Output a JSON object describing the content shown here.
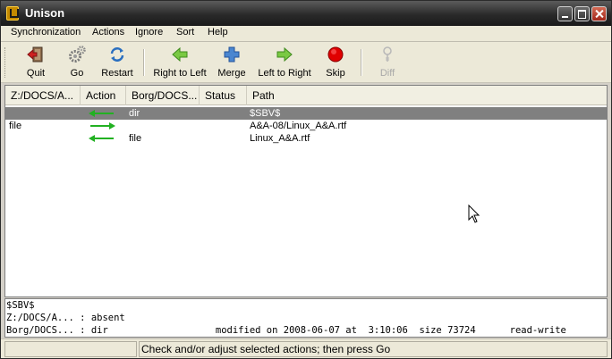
{
  "window": {
    "title": "Unison"
  },
  "menu": [
    "Synchronization",
    "Actions",
    "Ignore",
    "Sort",
    "Help"
  ],
  "toolbar": {
    "buttons": [
      {
        "label": "Quit",
        "icon": "quit-icon",
        "enabled": true
      },
      {
        "label": "Go",
        "icon": "gears-icon",
        "enabled": true
      },
      {
        "label": "Restart",
        "icon": "restart-icon",
        "enabled": true
      },
      {
        "label": "Right to Left",
        "icon": "arrow-left-icon",
        "enabled": true
      },
      {
        "label": "Merge",
        "icon": "plus-icon",
        "enabled": true
      },
      {
        "label": "Left to Right",
        "icon": "arrow-right-icon",
        "enabled": true
      },
      {
        "label": "Skip",
        "icon": "red-circle-icon",
        "enabled": true
      },
      {
        "label": "Diff",
        "icon": "diff-icon",
        "enabled": false
      }
    ]
  },
  "list": {
    "columns": [
      "Z:/DOCS/A...",
      "Action",
      "Borg/DOCS...",
      "Status",
      "Path"
    ],
    "rows": [
      {
        "left": "",
        "action": "right-to-left",
        "right": "dir",
        "status": "",
        "path": "$SBV$",
        "selected": true
      },
      {
        "left": "file",
        "action": "left-to-right",
        "right": "",
        "status": "",
        "path": "A&A-08/Linux_A&A.rtf",
        "selected": false
      },
      {
        "left": "",
        "action": "right-to-left",
        "right": "file",
        "status": "",
        "path": "Linux_A&A.rtf",
        "selected": false
      }
    ]
  },
  "details": {
    "path": "$SBV$",
    "left_line": "Z:/DOCS/A... : absent",
    "right_line": "Borg/DOCS... : dir                   modified on 2008-06-07 at  3:10:06  size 73724      read-write"
  },
  "status": {
    "message": "Check and/or adjust selected actions; then press Go"
  },
  "colors": {
    "arrow": "#22b122",
    "selected_row": "#808080",
    "skip": "#e00000"
  }
}
